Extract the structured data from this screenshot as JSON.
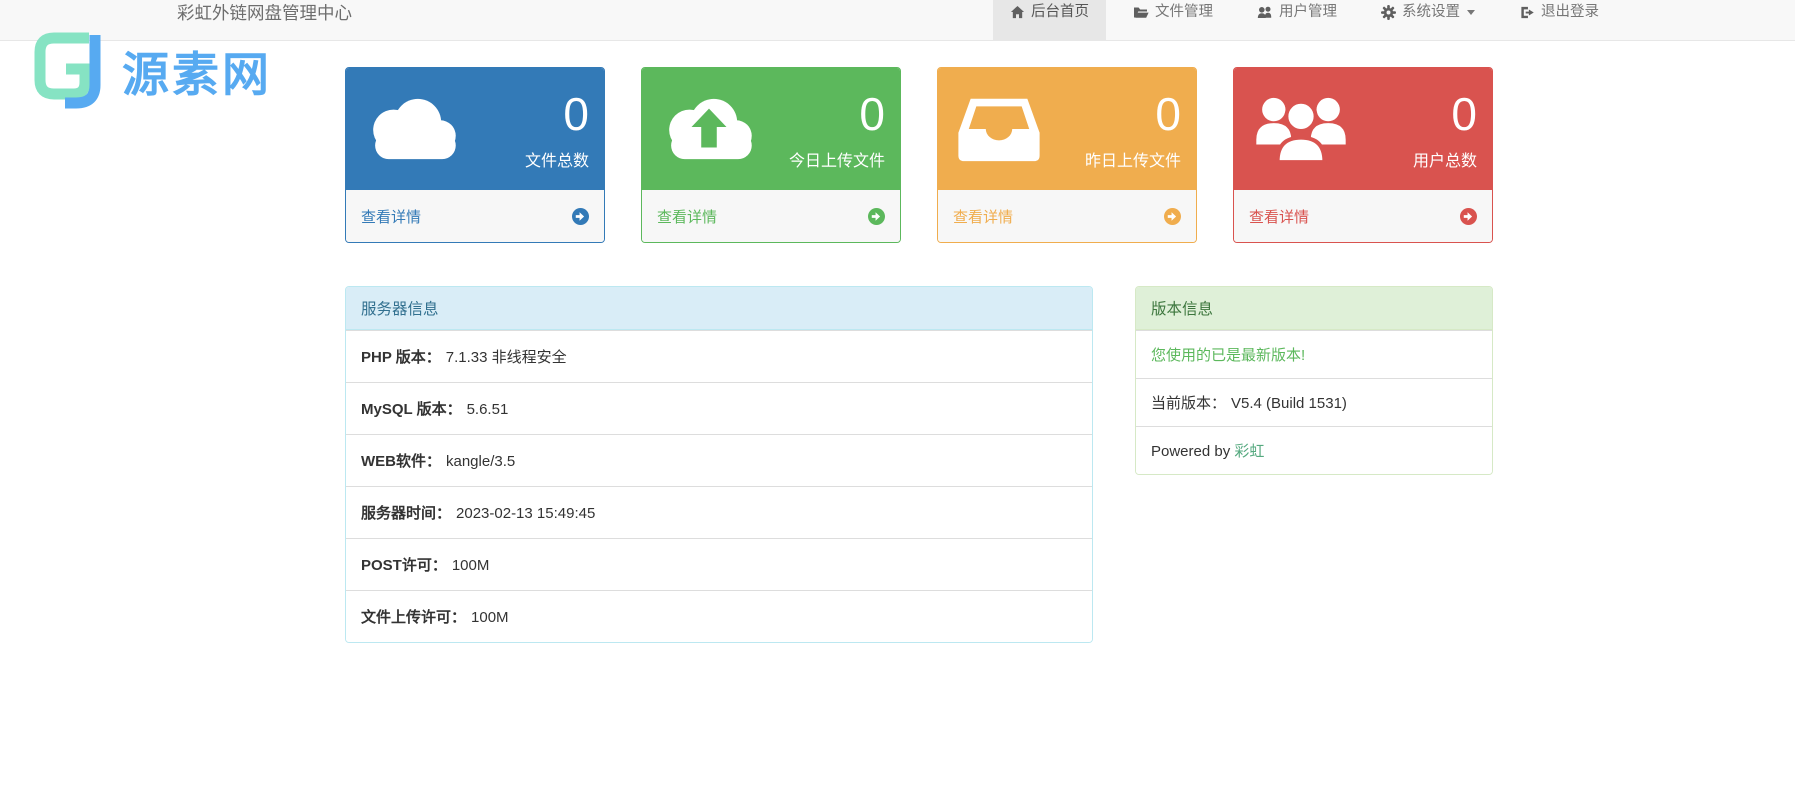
{
  "navbar": {
    "title": "彩虹外链网盘管理中心",
    "items": [
      {
        "label": "后台首页",
        "icon": "home-icon",
        "active": true
      },
      {
        "label": "文件管理",
        "icon": "folder-open-icon",
        "active": false
      },
      {
        "label": "用户管理",
        "icon": "users-icon",
        "active": false
      },
      {
        "label": "系统设置",
        "icon": "gear-icon",
        "has_caret": true,
        "active": false
      },
      {
        "label": "退出登录",
        "icon": "sign-out-icon",
        "active": false
      }
    ]
  },
  "watermark": {
    "text": "源素网",
    "icon": "gj-monogram-logo",
    "colors": {
      "mint": "#86e3c3",
      "blue": "#57aaf1"
    }
  },
  "stat_cards": [
    {
      "id": "files-total",
      "icon": "cloud-icon",
      "value": "0",
      "label": "文件总数",
      "link_label": "查看详情",
      "color": "#337ab7"
    },
    {
      "id": "today-uploads",
      "icon": "cloud-upload-icon",
      "value": "0",
      "label": "今日上传文件",
      "link_label": "查看详情",
      "color": "#5cb85c"
    },
    {
      "id": "yesterday-uploads",
      "icon": "inbox-icon",
      "value": "0",
      "label": "昨日上传文件",
      "link_label": "查看详情",
      "color": "#f0ad4e"
    },
    {
      "id": "users-total",
      "icon": "users-group-icon",
      "value": "0",
      "label": "用户总数",
      "link_label": "查看详情",
      "color": "#d9534f"
    }
  ],
  "server_panel": {
    "title": "服务器信息",
    "rows": [
      {
        "label": "PHP 版本：",
        "value": "7.1.33 非线程安全"
      },
      {
        "label": "MySQL 版本：",
        "value": "5.6.51"
      },
      {
        "label": "WEB软件：",
        "value": "kangle/3.5"
      },
      {
        "label": "服务器时间：",
        "value": "2023-02-13 15:49:45"
      },
      {
        "label": "POST许可：",
        "value": "100M"
      },
      {
        "label": "文件上传许可：",
        "value": "100M"
      }
    ]
  },
  "version_panel": {
    "title": "版本信息",
    "latest_message": "您使用的已是最新版本!",
    "current_version_label": "当前版本：",
    "current_version_value": "V5.4 (Build 1531)",
    "powered_by_prefix": "Powered by ",
    "powered_by_link": "彩虹"
  },
  "colors": {
    "navbar_bg": "#f8f8f8",
    "navbar_active_bg": "#e7e7e7",
    "panel_info_header_bg": "#d9edf7",
    "panel_info_text": "#31708f",
    "panel_success_header_bg": "#dff0d8",
    "panel_success_text": "#3c763d",
    "latest_message_color": "#5cb85c",
    "powered_link_color": "#55a97f"
  }
}
